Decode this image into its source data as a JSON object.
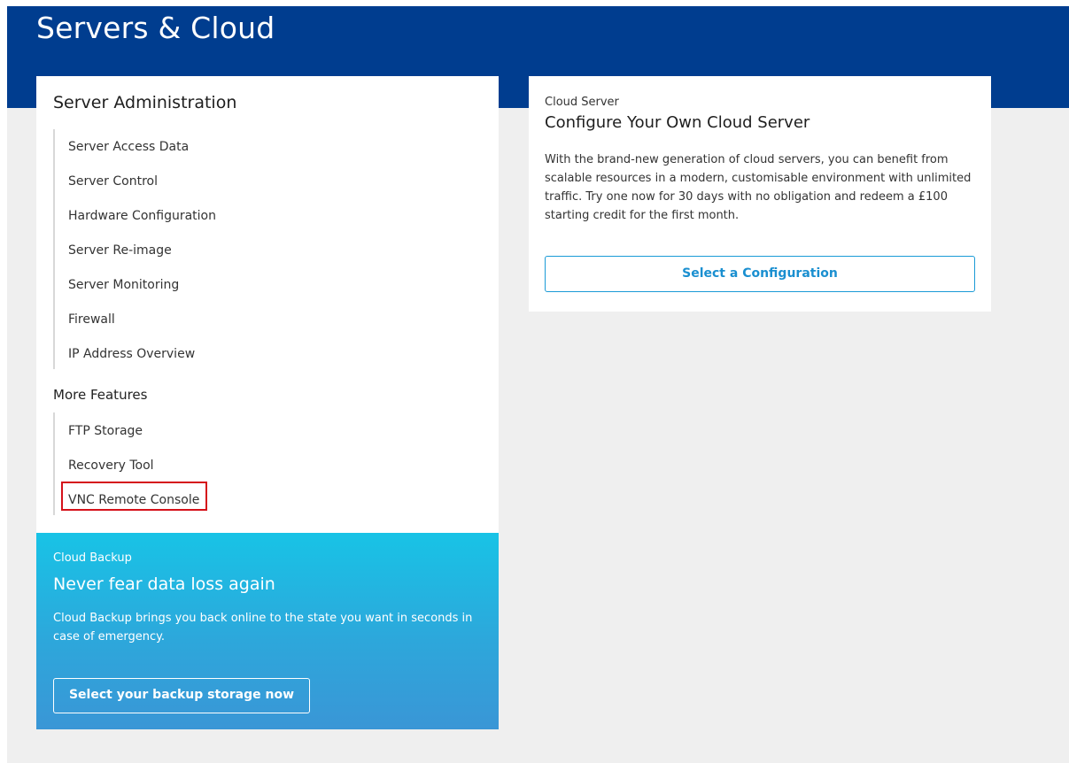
{
  "header": {
    "title": "Servers & Cloud"
  },
  "server_admin": {
    "title": "Server Administration",
    "items": [
      {
        "label": "Server Access Data"
      },
      {
        "label": "Server Control"
      },
      {
        "label": "Hardware Configuration"
      },
      {
        "label": "Server Re-image"
      },
      {
        "label": "Server Monitoring"
      },
      {
        "label": "Firewall"
      },
      {
        "label": "IP Address Overview"
      }
    ]
  },
  "more_features": {
    "title": "More Features",
    "items": [
      {
        "label": "FTP Storage"
      },
      {
        "label": "Recovery Tool"
      },
      {
        "label": "VNC Remote Console",
        "highlighted": true
      }
    ]
  },
  "cloud_backup": {
    "kicker": "Cloud Backup",
    "heading": "Never fear data loss again",
    "description": "Cloud Backup brings you back online to the state you want in seconds in case of emergency.",
    "button_label": "Select your backup storage now"
  },
  "cloud_server": {
    "kicker": "Cloud Server",
    "heading": "Configure Your Own Cloud Server",
    "description": "With the brand-new generation of cloud servers, you can benefit from scalable resources in a modern, customisable environment with unlimited traffic. Try one now for 30 days with no obligation and redeem a £100 starting credit for the first month.",
    "button_label": "Select a Configuration"
  },
  "colors": {
    "header_blue": "#003d8f",
    "highlight_red": "#d5111a",
    "accent_blue": "#1a8fd0",
    "backup_gradient_top": "#18c3e6",
    "backup_gradient_bottom": "#3a96d6"
  }
}
